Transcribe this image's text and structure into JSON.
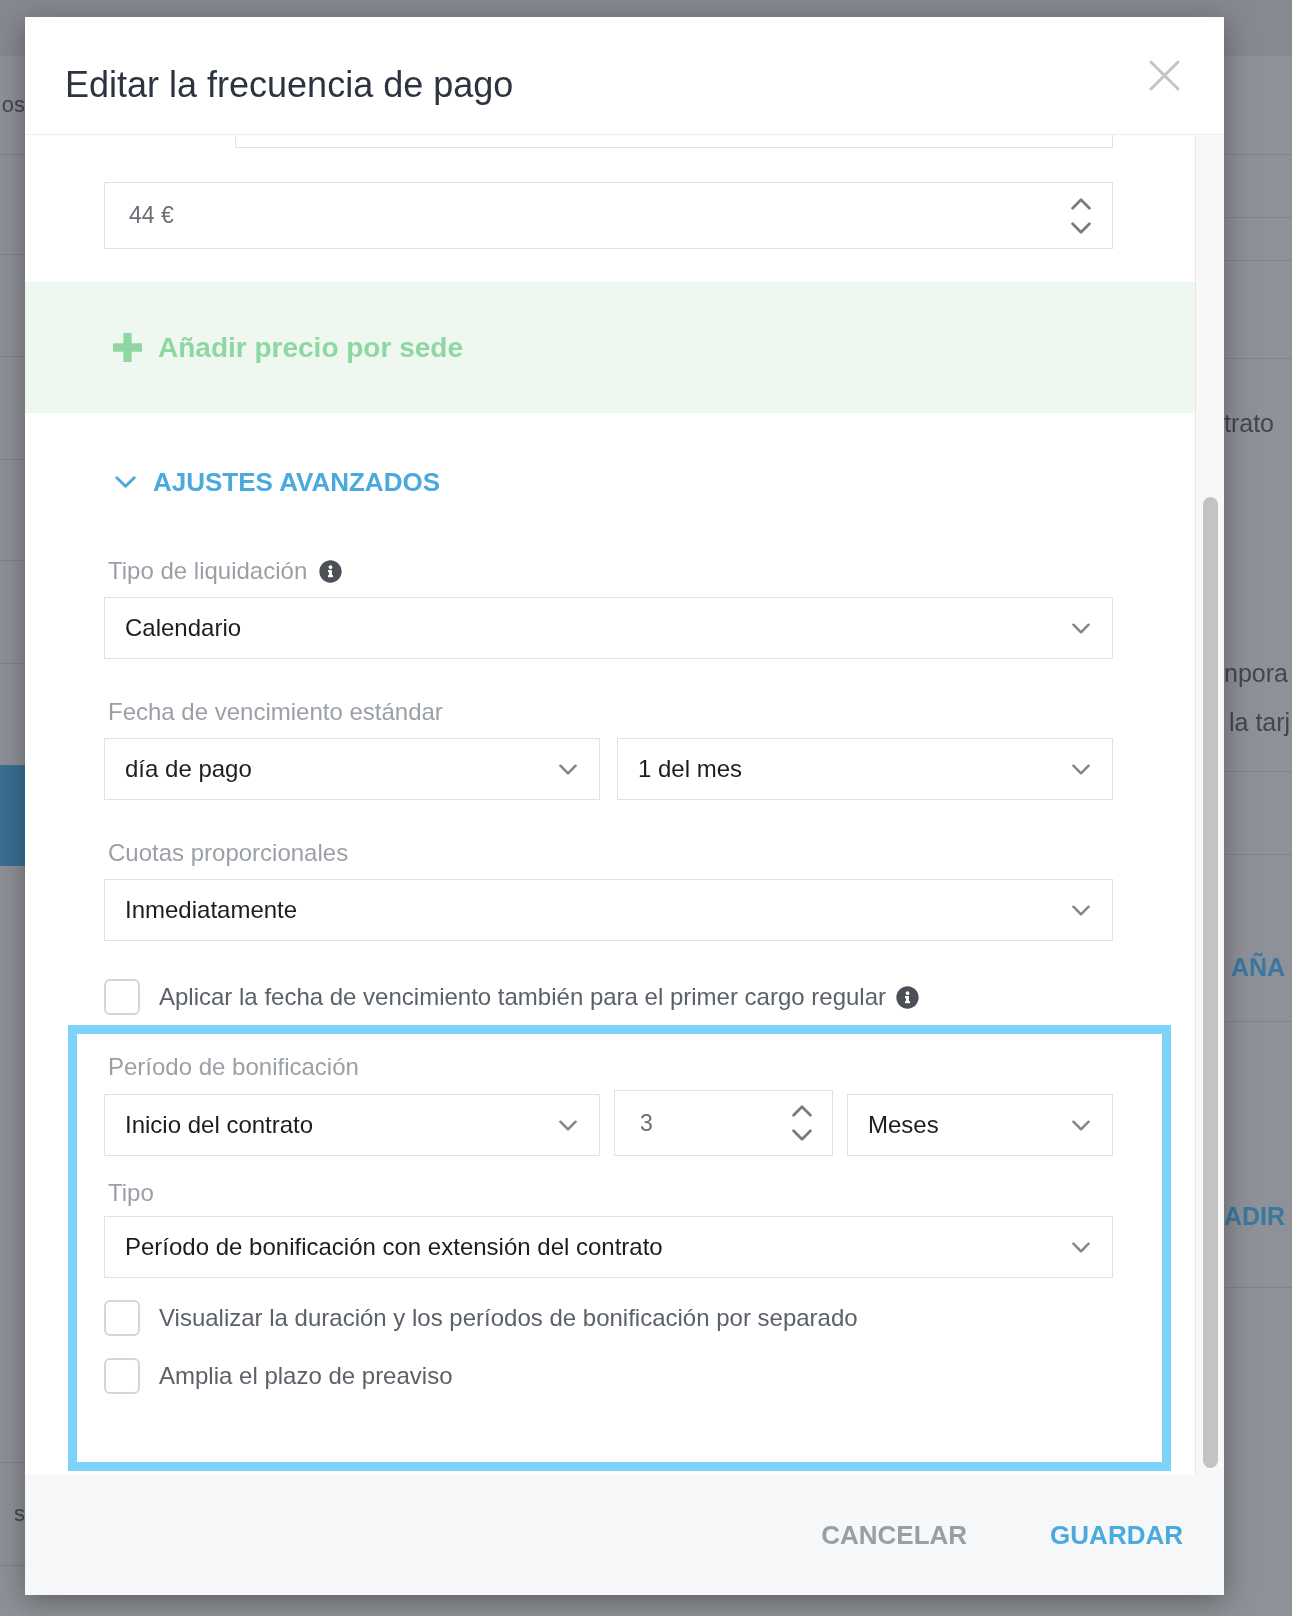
{
  "background": {
    "left_texts": [
      "os",
      "s"
    ],
    "right_texts": [
      {
        "text": "trato",
        "kind": "plain"
      },
      {
        "text": "npora",
        "kind": "plain"
      },
      {
        "text": "la tarj",
        "kind": "plain"
      },
      {
        "text": "AÑA",
        "kind": "action"
      },
      {
        "text": "ADIR",
        "kind": "action"
      }
    ]
  },
  "dialog": {
    "title": "Editar la frecuencia de pago"
  },
  "price_field": {
    "value": "44 €"
  },
  "add_price": {
    "label": "Añadir precio por sede"
  },
  "advanced": {
    "title": "AJUSTES AVANZADOS",
    "expanded": true,
    "fields": [
      {
        "kind": "select_group",
        "label": "Tipo de liquidación",
        "info": true,
        "controls": [
          {
            "kind": "select",
            "value": "Calendario"
          }
        ]
      },
      {
        "kind": "select_group",
        "label": "Fecha de vencimiento estándar",
        "info": false,
        "controls": [
          {
            "kind": "select",
            "value": "día de pago"
          },
          {
            "kind": "select",
            "value": "1 del mes"
          }
        ]
      },
      {
        "kind": "select_group",
        "label": "Cuotas proporcionales",
        "info": false,
        "controls": [
          {
            "kind": "select",
            "value": "Inmediatamente"
          }
        ]
      },
      {
        "kind": "checkbox",
        "label": "Aplicar la fecha de vencimiento también para el primer cargo regular",
        "checked": false,
        "info": true
      }
    ],
    "grace_period": {
      "highlighted": true,
      "fields": [
        {
          "kind": "select_group",
          "label": "Período de bonificación",
          "info": false,
          "controls": [
            {
              "kind": "select",
              "value": "Inicio del contrato"
            },
            {
              "kind": "number",
              "value": "3"
            },
            {
              "kind": "select",
              "value": "Meses"
            }
          ]
        },
        {
          "kind": "select_group",
          "label": "Tipo",
          "info": false,
          "controls": [
            {
              "kind": "select",
              "value": "Período de bonificación con extensión del contrato"
            }
          ]
        },
        {
          "kind": "checkbox",
          "label": "Visualizar la duración y los períodos de bonificación por separado",
          "checked": false,
          "info": false
        },
        {
          "kind": "checkbox",
          "label": "Amplia el plazo de preaviso",
          "checked": false,
          "info": false
        }
      ]
    }
  },
  "footer": {
    "buttons": [
      {
        "label": "CANCELAR",
        "kind": "secondary"
      },
      {
        "label": "GUARDAR",
        "kind": "primary"
      }
    ]
  }
}
